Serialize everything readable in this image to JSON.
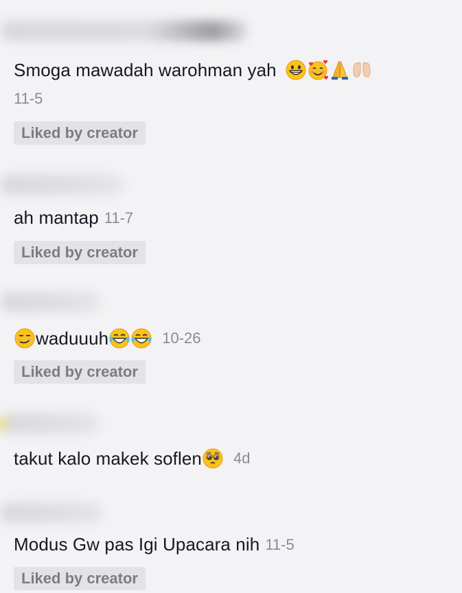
{
  "comments": [
    {
      "text": "Smoga mawadah warohman yah",
      "emojis": [
        "grinning-face-icon",
        "smiling-face-with-hearts-icon",
        "folded-hands-icon",
        "raised-hands-icon"
      ],
      "time": "11-5",
      "liked_label": "Liked by creator"
    },
    {
      "text": "ah mantap",
      "time": "11-7",
      "liked_label": "Liked by creator"
    },
    {
      "text": "waduuuh",
      "emojis": [
        "smirking-face-icon",
        "tears-of-joy-icon",
        "tears-of-joy-icon"
      ],
      "time": "10-26",
      "liked_label": "Liked by creator"
    },
    {
      "text": "takut kalo makek soflen",
      "emojis": [
        "pleading-face-icon"
      ],
      "time": "4d"
    },
    {
      "text": "Modus Gw pas Igi Upacara nih",
      "time": "11-5",
      "liked_label": "Liked by creator"
    }
  ],
  "colors": {
    "background": "#f3f2f4",
    "text": "#161823",
    "timestamp": "#8a8b91",
    "liked_badge_bg": "#e3e2e6",
    "liked_badge_text": "#7c7d82"
  }
}
